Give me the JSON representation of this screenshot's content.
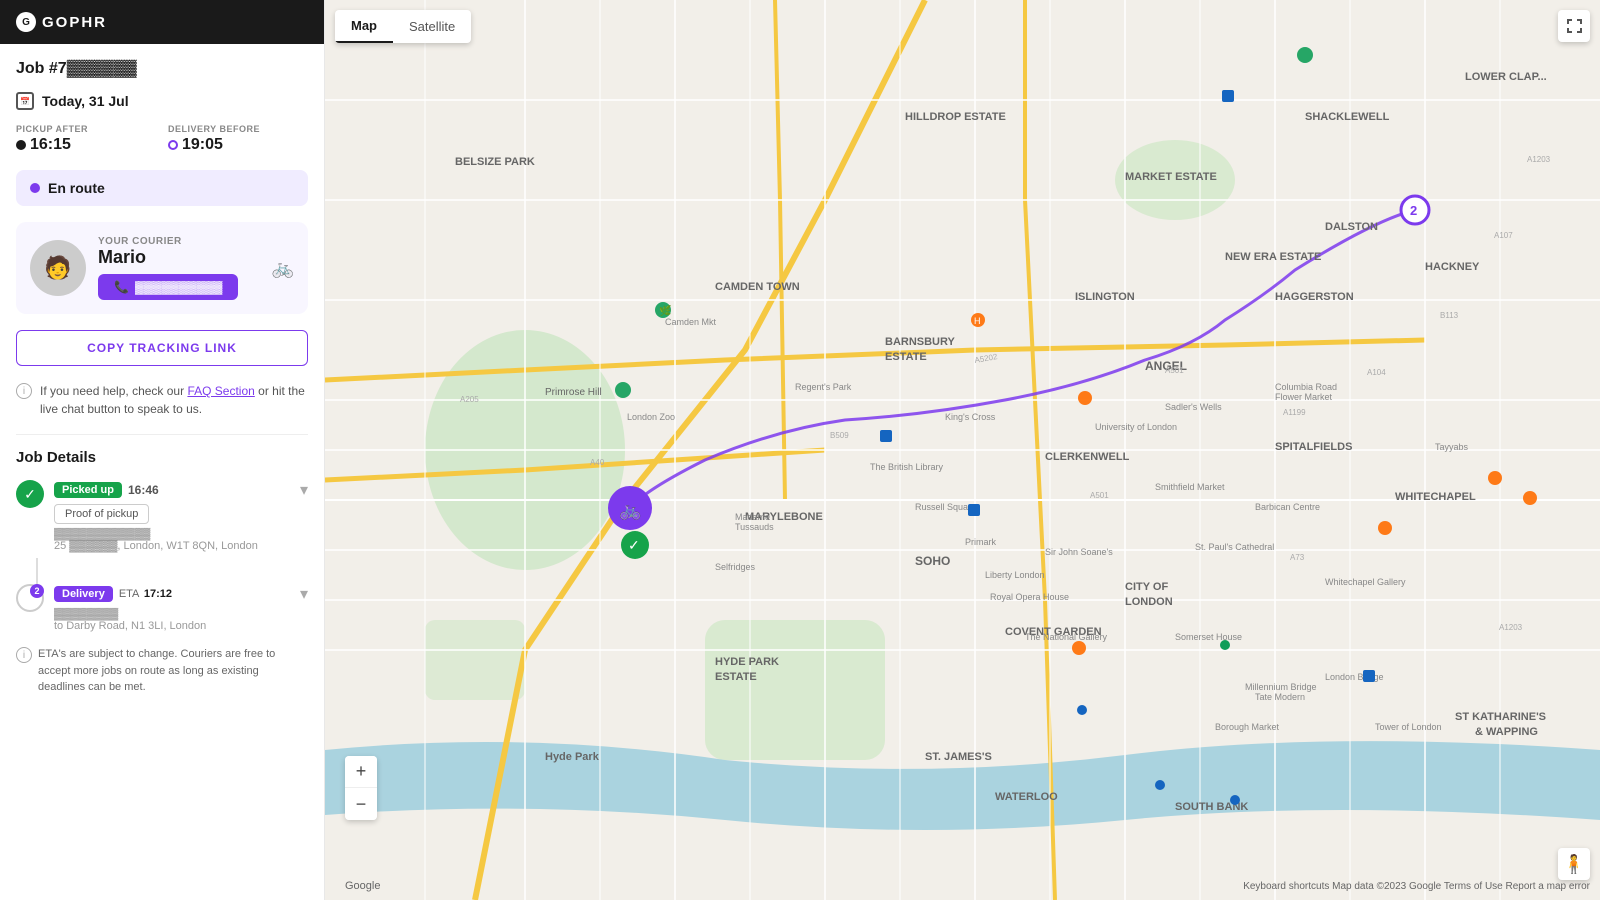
{
  "app": {
    "logo_text": "GOPHR",
    "logo_char": "G"
  },
  "sidebar": {
    "job_number": "Job #7▓▓▓▓▓▓",
    "date": "Today, 31 Jul",
    "pickup_label": "PICKUP AFTER",
    "pickup_time": "16:15",
    "delivery_label": "DELIVERY BEFORE",
    "delivery_time": "19:05",
    "status": "En route",
    "courier": {
      "label": "YOUR COURIER",
      "name": "Mario",
      "phone_label": "▓▓▓▓▓▓▓▓▓▓",
      "avatar_char": "👤"
    },
    "tracking_button": "COPY TRACKING LINK",
    "help_text_pre": "If you need help, check our ",
    "help_faq": "FAQ Section",
    "help_text_post": " or hit the live chat button to speak to us.",
    "job_details_title": "Job Details",
    "pickup_badge": "Picked up",
    "pickup_time_stamp": "16:46",
    "proof_button": "Proof of pickup",
    "pickup_address_line1": "▓▓▓▓▓▓▓▓▓▓▓▓",
    "pickup_address_line2": "25 ▓▓▓▓▓▓, London, W1T 8QN, London",
    "delivery_badge": "Delivery",
    "delivery_number": "2",
    "delivery_eta_label": "ETA",
    "delivery_eta": "17:12",
    "delivery_address_line1": "▓▓▓▓▓▓▓▓",
    "delivery_address_line2": "to Darby Road, N1 3LI, London",
    "eta_note": "ETA's are subject to change. Couriers are free to accept more jobs on route as long as existing deadlines can be met.",
    "call_button_label": "▓▓▓▓▓▓▓▓▓▓"
  },
  "map": {
    "tab_map": "Map",
    "tab_satellite": "Satellite",
    "zoom_in": "+",
    "zoom_out": "−",
    "attribution": "Keyboard shortcuts  Map data ©2023 Google  Terms of Use  Report a map error",
    "google_logo": "Google"
  }
}
